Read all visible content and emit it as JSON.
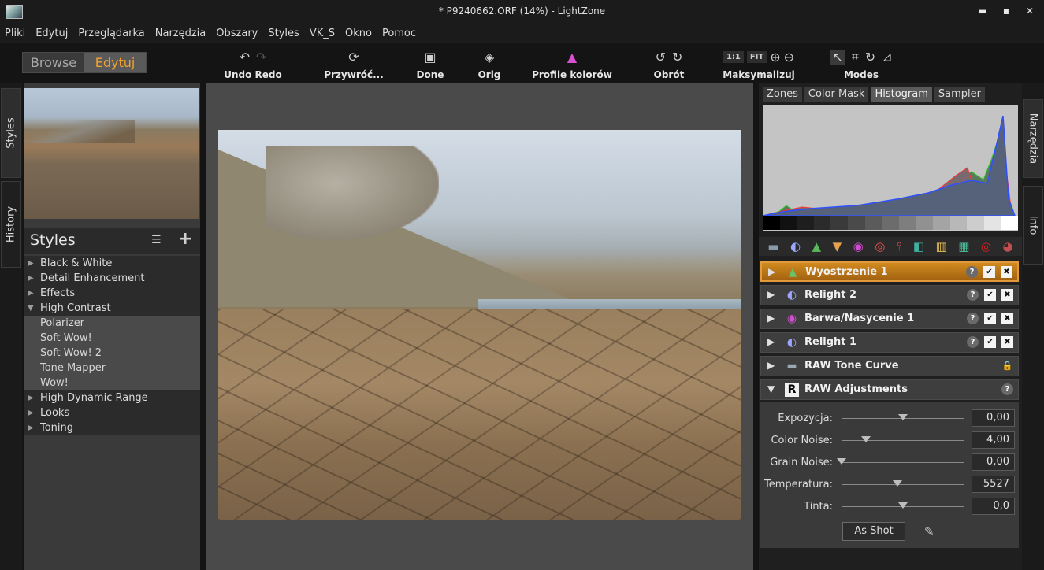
{
  "window": {
    "title": "* P9240662.ORF (14%) - LightZone",
    "minimize": "▬",
    "maximize": "▪",
    "close": "✕"
  },
  "menu": [
    "Pliki",
    "Edytuj",
    "Przeglądarka",
    "Narzędzia",
    "Obszary",
    "Styles",
    "VK_S",
    "Okno",
    "Pomoc"
  ],
  "toolbar": {
    "browse": "Browse",
    "edit": "Edytuj",
    "undo_redo": "Undo Redo",
    "restore": "Przywróć...",
    "done": "Done",
    "orig": "Orig",
    "color_profiles": "Profile kolorów",
    "rotate": "Obrót",
    "maximize": "Maksymalizuj",
    "zoom_1to1": "1:1",
    "zoom_fit": "FIT",
    "modes": "Modes"
  },
  "left_tabs": {
    "styles": "Styles",
    "history": "History"
  },
  "right_tabs": {
    "tools": "Narzędzia",
    "info": "Info"
  },
  "styles_panel": {
    "title": "Styles",
    "groups": [
      {
        "label": "Black & White",
        "expanded": false
      },
      {
        "label": "Detail Enhancement",
        "expanded": false
      },
      {
        "label": "Effects",
        "expanded": false
      },
      {
        "label": "High Contrast",
        "expanded": true
      },
      {
        "label": "Polarizer",
        "child": true
      },
      {
        "label": "Soft Wow!",
        "child": true
      },
      {
        "label": "Soft Wow! 2",
        "child": true
      },
      {
        "label": "Tone Mapper",
        "child": true
      },
      {
        "label": "Wow!",
        "child": true
      },
      {
        "label": "High Dynamic Range",
        "expanded": false
      },
      {
        "label": "Looks",
        "expanded": false
      },
      {
        "label": "Toning",
        "expanded": false
      }
    ]
  },
  "info_tabs": [
    {
      "label": "Zones",
      "active": false
    },
    {
      "label": "Color Mask",
      "active": false
    },
    {
      "label": "Histogram",
      "active": true
    },
    {
      "label": "Sampler",
      "active": false
    }
  ],
  "tool_stack": [
    {
      "label": "Wyostrzenie 1",
      "icon": "sharpen-icon",
      "active": true
    },
    {
      "label": "Relight 2",
      "icon": "relight-icon",
      "active": false
    },
    {
      "label": "Barwa/Nasycenie 1",
      "icon": "hue-saturation-icon",
      "active": false
    },
    {
      "label": "Relight 1",
      "icon": "relight-icon",
      "active": false
    },
    {
      "label": "RAW Tone Curve",
      "icon": "tone-curve-icon",
      "locked": true
    },
    {
      "label": "RAW Adjustments",
      "icon": "raw-icon",
      "expanded": true
    }
  ],
  "raw_adjustments": {
    "sliders": [
      {
        "label": "Expozycja:",
        "value": "0,00",
        "level": 0.5
      },
      {
        "label": "Color Noise:",
        "value": "4,00",
        "level": 0.2
      },
      {
        "label": "Grain Noise:",
        "value": "0,00",
        "level": 0.0
      },
      {
        "label": "Temperatura:",
        "value": "5527",
        "level": 0.46
      },
      {
        "label": "Tinta:",
        "value": "0,0",
        "level": 0.5
      }
    ],
    "as_shot": "As Shot"
  },
  "colors": {
    "accent_orange": "#f0a030",
    "active_tool": "#c47a1a",
    "panel_bg": "#3a3a3a"
  }
}
